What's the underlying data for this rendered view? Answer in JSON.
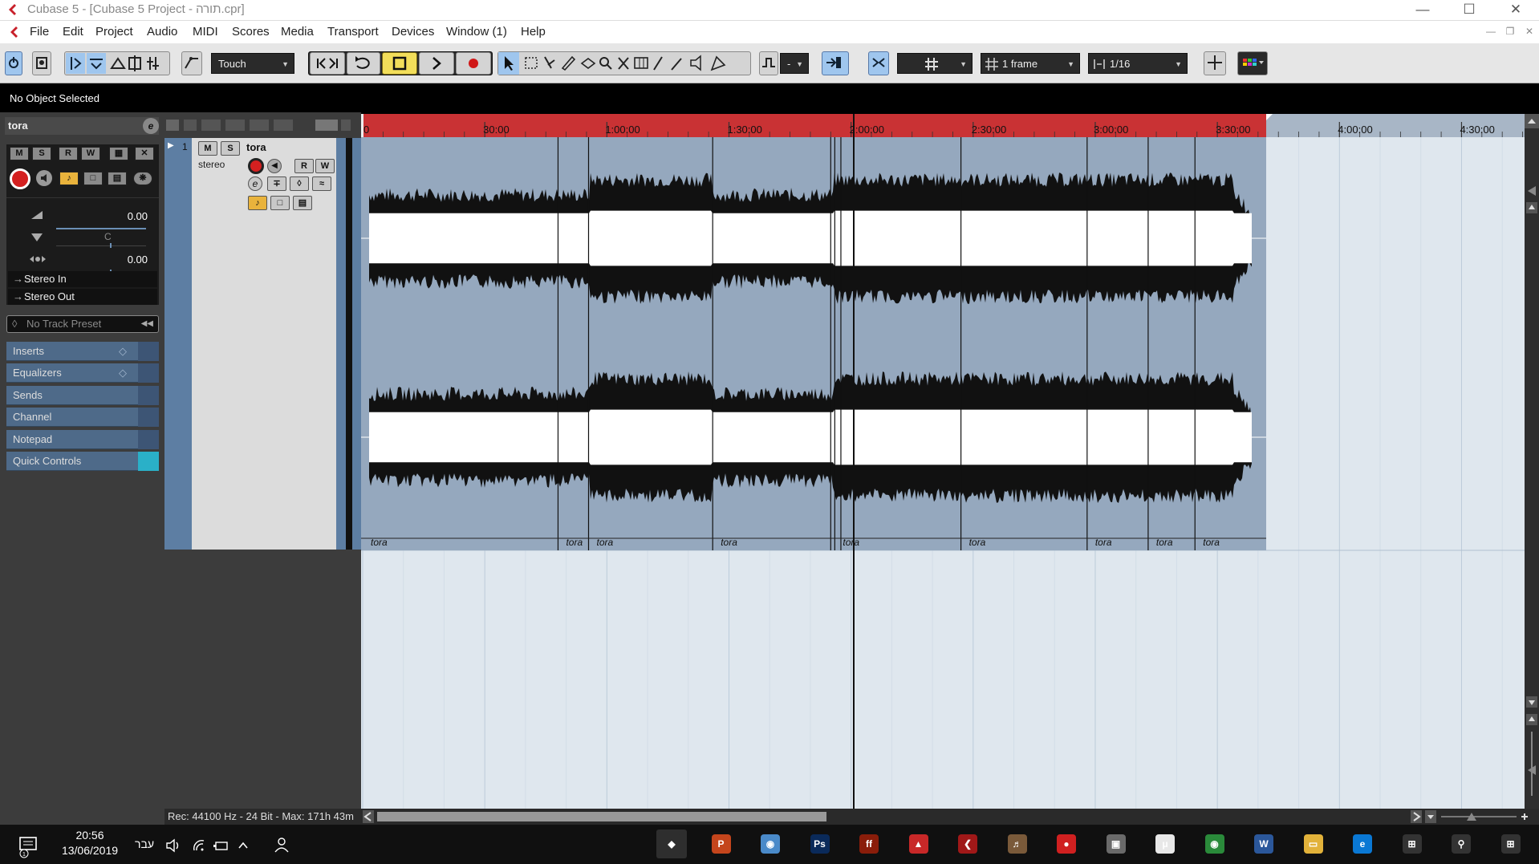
{
  "window": {
    "title": "Cubase 5 - [Cubase 5 Project - תורה.cpr]"
  },
  "menu": [
    "File",
    "Edit",
    "Project",
    "Audio",
    "MIDI",
    "Scores",
    "Media",
    "Transport",
    "Devices",
    "Window (1)",
    "Help"
  ],
  "toolbar": {
    "automation_mode": "Touch",
    "grid_type": "1 frame",
    "quantize": "1/16",
    "nudge_value": "-"
  },
  "status": {
    "selection": "No Object Selected"
  },
  "inspector": {
    "track_name": "tora",
    "volume": "0.00",
    "pan": "C",
    "delay": "0.00",
    "input": "Stereo In",
    "output": "Stereo Out",
    "preset_placeholder": "No Track Preset",
    "sections": [
      "Inserts",
      "Equalizers",
      "Sends",
      "Channel",
      "Notepad",
      "Quick Controls"
    ],
    "buttons": {
      "mute": "M",
      "solo": "S",
      "read": "R",
      "write": "W"
    }
  },
  "track": {
    "number": "1",
    "name": "tora",
    "type": "stereo",
    "buttons": {
      "mute": "M",
      "solo": "S",
      "read": "R",
      "write": "W"
    }
  },
  "ruler": {
    "labels": [
      "0",
      "30:00",
      "1:00:00",
      "1:30:00",
      "2:00:00",
      "2:30:00",
      "3:00:00",
      "3:30:00",
      "4:00:00",
      "4:30:00"
    ],
    "minutes": [
      0,
      30,
      60,
      90,
      120,
      150,
      180,
      210,
      240,
      270
    ],
    "locator_end_minutes": 222,
    "cursor_minutes": 120.5
  },
  "events": {
    "label": "tora",
    "start_minutes": [
      0,
      48,
      55.5,
      86,
      116,
      147,
      178,
      193,
      204.5
    ],
    "extra_splits_minutes": [
      115,
      117.5
    ],
    "end_minutes": 222
  },
  "recording_info": "Rec: 44100 Hz - 24 Bit - Max: 171h 43m",
  "taskbar": {
    "time": "20:56",
    "date": "13/06/2019",
    "language": "עבר",
    "apps": [
      "Cubase",
      "PowerPoint",
      "Paint",
      "Photoshop",
      "FontForge",
      "Acrobat",
      "Cubase 5",
      "Audio editor",
      "Opera",
      "Scanner",
      "Meetup",
      "Chrome",
      "Word",
      "File Explorer",
      "Edge",
      "Task View",
      "Search",
      "Start"
    ],
    "colors": [
      "#2e2e2e",
      "#c4451c",
      "#4a8ac9",
      "#0a2a5a",
      "#8a1d0a",
      "#c82828",
      "#a01818",
      "#7a5a3a",
      "#d02020",
      "#6a6a6a",
      "#e8e8e8",
      "#2a8a3a",
      "#2b579a",
      "#e2b23a",
      "#0a78d4",
      "#333",
      "#333",
      "#333"
    ]
  },
  "colors": {
    "ruler_range": "#c93234",
    "event_bg": "#95a8be",
    "inspector_section": "#4e6a89",
    "transport_stop": "#f2de5a",
    "active_tool": "#9fc6ee"
  }
}
